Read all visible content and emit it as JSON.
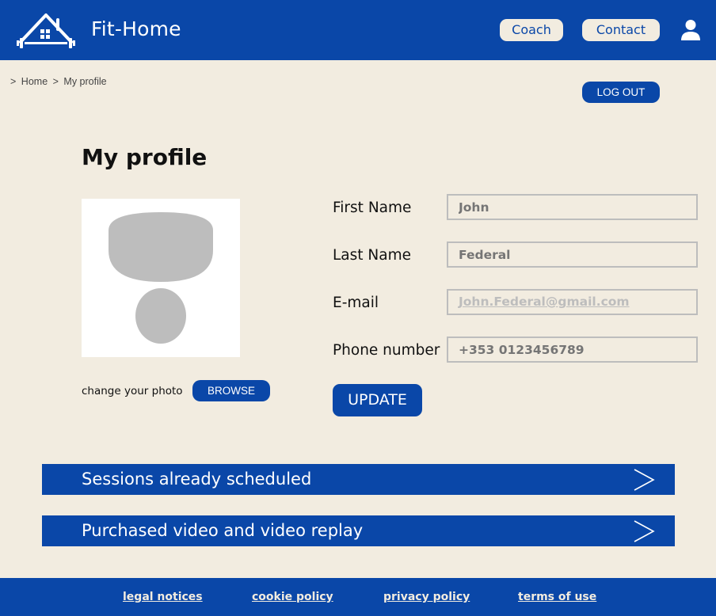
{
  "header": {
    "brand": "Fit-Home",
    "nav": {
      "coach": "Coach",
      "contact": "Contact"
    },
    "icons": {
      "logo": "home-dumbbell-logo",
      "user": "user-icon"
    },
    "colors": {
      "primary": "#0a47a8",
      "background": "#f2ece0"
    }
  },
  "breadcrumb": {
    "sep1": ">",
    "home": "Home",
    "sep2": ">",
    "current": "My profile"
  },
  "logout_label": "LOG OUT",
  "page_title": "My profile",
  "photo": {
    "change_label": "change your photo",
    "browse_label": "BROWSE"
  },
  "form": {
    "first_name": {
      "label": "First Name",
      "placeholder": "John"
    },
    "last_name": {
      "label": "Last Name",
      "placeholder": "Federal"
    },
    "email": {
      "label": "E-mail",
      "placeholder": "John.Federal@gmail.com"
    },
    "phone": {
      "label": "Phone number",
      "placeholder": "+353 0123456789"
    },
    "update_label": "UPDATE"
  },
  "sections": {
    "sessions": "Sessions already scheduled",
    "videos": "Purchased video and video replay"
  },
  "footer": {
    "legal": "legal notices",
    "cookie": "cookie policy",
    "privacy": "privacy policy",
    "terms": "terms of use"
  }
}
